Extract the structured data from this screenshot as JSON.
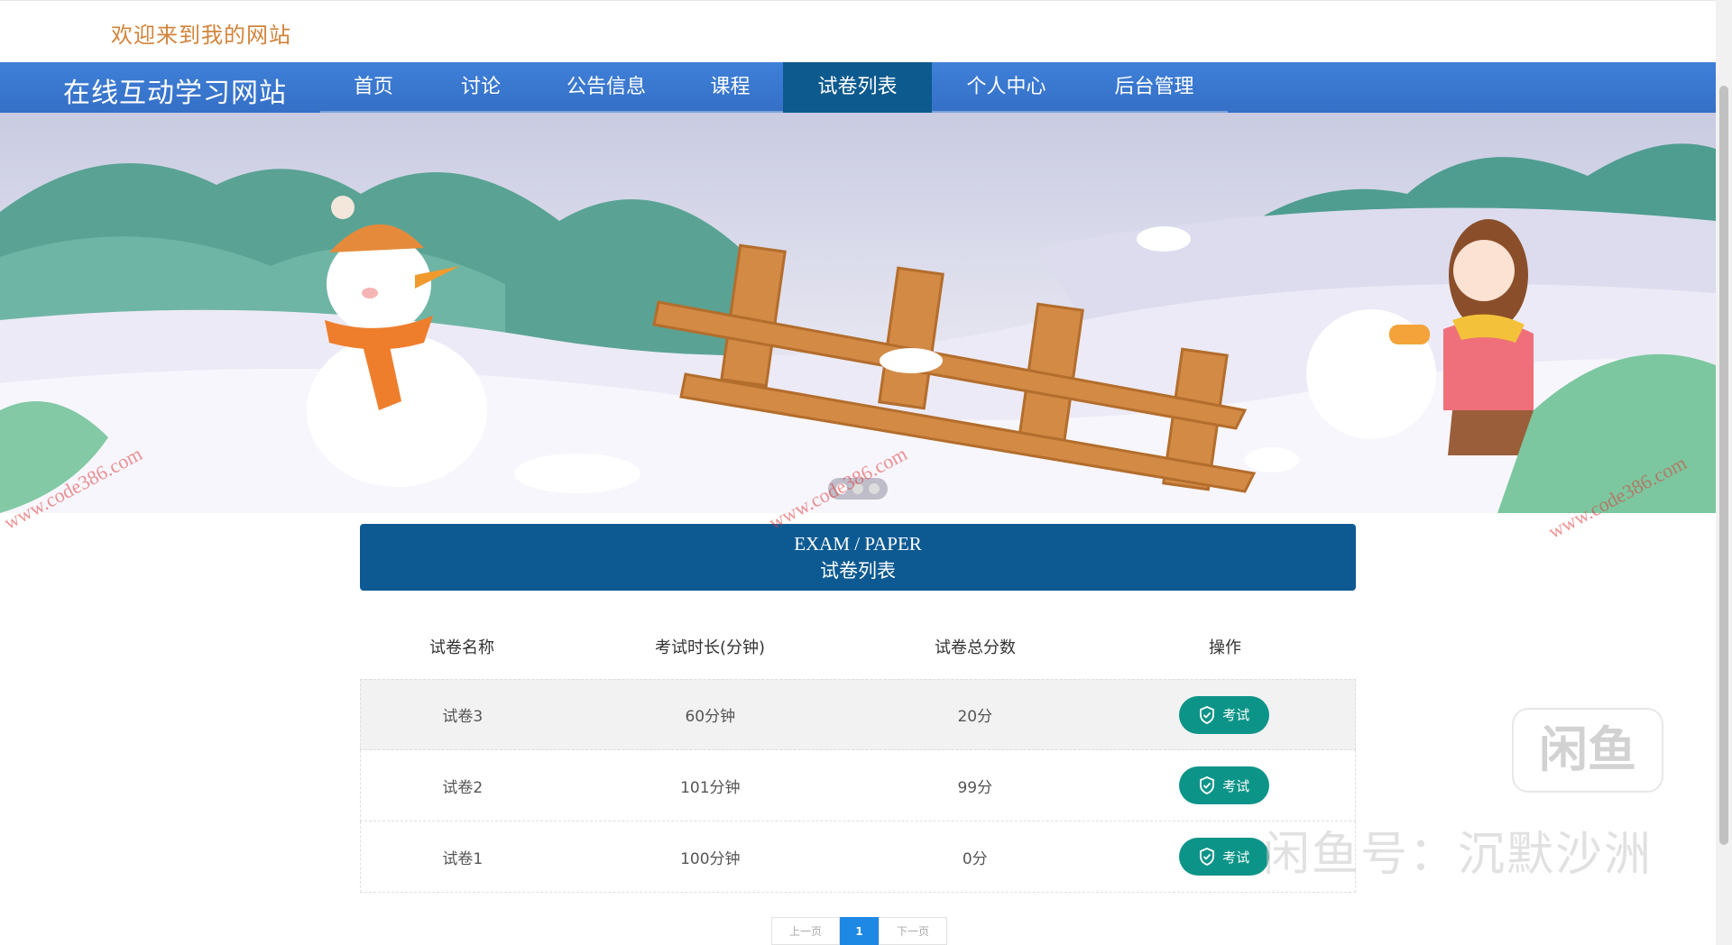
{
  "header": {
    "welcome": "欢迎来到我的网站"
  },
  "nav": {
    "brand": "在线互动学习网站",
    "items": [
      {
        "label": "首页",
        "active": false
      },
      {
        "label": "讨论",
        "active": false
      },
      {
        "label": "公告信息",
        "active": false
      },
      {
        "label": "课程",
        "active": false
      },
      {
        "label": "试卷列表",
        "active": true
      },
      {
        "label": "个人中心",
        "active": false
      },
      {
        "label": "后台管理",
        "active": false
      }
    ]
  },
  "banner": {
    "slide_count": 3,
    "current_slide": 1
  },
  "section": {
    "title_en": "EXAM / PAPER",
    "title_cn": "试卷列表"
  },
  "table": {
    "headers": [
      "试卷名称",
      "考试时长(分钟)",
      "试卷总分数",
      "操作"
    ],
    "rows": [
      {
        "name": "试卷3",
        "duration": "60分钟",
        "score": "20分",
        "action": "考试"
      },
      {
        "name": "试卷2",
        "duration": "101分钟",
        "score": "99分",
        "action": "考试"
      },
      {
        "name": "试卷1",
        "duration": "100分钟",
        "score": "0分",
        "action": "考试"
      }
    ]
  },
  "pager": {
    "prev": "上一页",
    "current": "1",
    "next": "下一页"
  },
  "watermarks": {
    "logo": "闲鱼",
    "seller": "闲鱼号：沉默沙洲",
    "url": "www.code386.com"
  },
  "colors": {
    "nav": "#3a7bd5",
    "active_nav": "#0c5a8e",
    "title_box": "#0d5a92",
    "button": "#0d9488",
    "welcome": "#d2843b"
  }
}
